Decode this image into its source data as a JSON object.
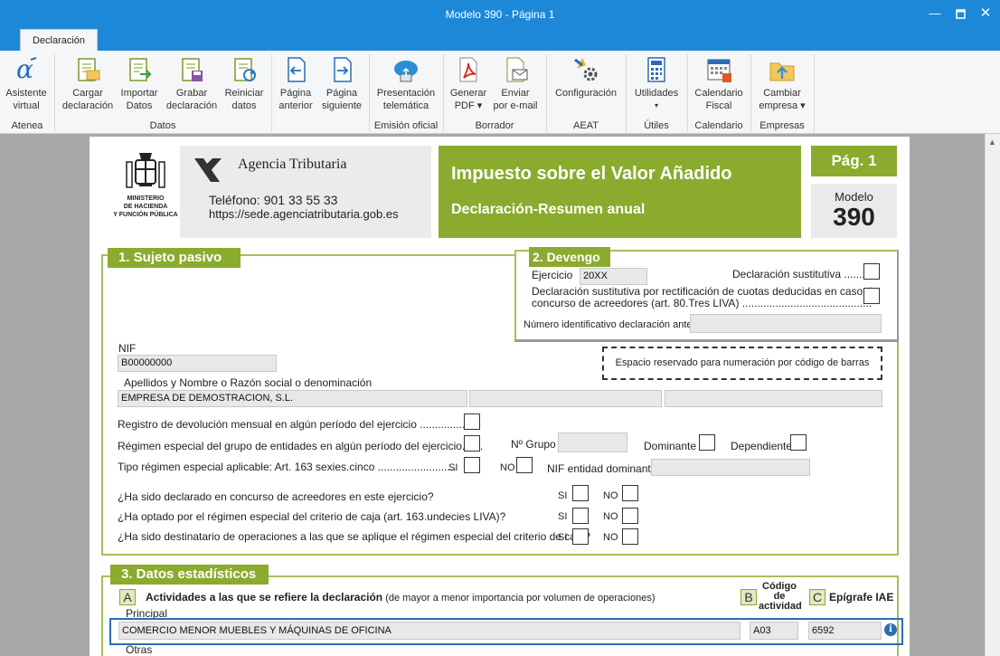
{
  "window": {
    "title": "Modelo 390 - Página 1"
  },
  "tabs": {
    "declaracion": "Declaración"
  },
  "ribbon": {
    "asistente": "Asistente",
    "virtual": "virtual",
    "cargar": "Cargar",
    "cargar2": "declaración",
    "importar": "Importar",
    "importar2": "Datos",
    "grabar": "Grabar",
    "grabar2": "declaración",
    "reiniciar": "Reiniciar",
    "reiniciar2": "datos",
    "pag_ant": "Página",
    "pag_ant2": "anterior",
    "pag_sig": "Página",
    "pag_sig2": "siguiente",
    "present": "Presentación",
    "present2": "telemática",
    "generar": "Generar",
    "generar2": "PDF ▾",
    "enviar": "Enviar",
    "enviar2": "por e-mail",
    "config": "Configuración",
    "utilidades": "Utilidades",
    "utilidades2": "▾",
    "calendario": "Calendario",
    "calendario2": "Fiscal",
    "cambiar": "Cambiar",
    "cambiar2": "empresa ▾",
    "groups": {
      "atenea": "Atenea",
      "datos": "Datos",
      "emision": "Emisión oficial",
      "borrador": "Borrador",
      "aeat": "AEAT",
      "utiles": "Útiles",
      "calendario": "Calendario",
      "empresas": "Empresas"
    }
  },
  "header": {
    "ministerio": "MINISTERIO",
    "de_hacienda": "DE HACIENDA",
    "funcion": "Y FUNCIÓN PÚBLICA",
    "agencia": "Agencia Tributaria",
    "telefono": "Teléfono: 901 33 55 33",
    "web": "https://sede.agenciatributaria.gob.es",
    "impuesto": "Impuesto sobre el Valor Añadido",
    "subtitulo": "Declaración-Resumen anual",
    "pag": "Pág. 1",
    "modelo_lbl": "Modelo",
    "modelo_num": "390"
  },
  "s1": {
    "title": "1. Sujeto pasivo",
    "nif_lbl": "NIF",
    "nif": "B00000000",
    "nombre_lbl": "Apellidos y Nombre o Razón social o denominación",
    "nombre": "EMPRESA DE DEMOSTRACION, S.L.",
    "barras": "Espacio reservado para numeración por código de barras",
    "reg_dev": "Registro de devolución mensual en algún período del ejercicio ..................",
    "reg_grupo": "Régimen especial del grupo de entidades en algún período del ejercicio.......",
    "n_grupo": "Nº Grupo",
    "dominante": "Dominante",
    "dependiente": "Dependiente",
    "tipo_reg": "Tipo régimen especial aplicable: Art. 163 sexies.cinco ..........................",
    "si": "SI",
    "no": "NO",
    "nif_dom": "NIF entidad dominante",
    "q1": "¿Ha sido declarado en concurso de acreedores en este ejercicio?",
    "q2": "¿Ha optado por el régimen especial del criterio de caja (art. 163.undecies LIVA)?",
    "q3": "¿Ha sido destinatario de operaciones a las que se aplique el régimen especial del criterio de caja?"
  },
  "s2": {
    "title": "2. Devengo",
    "ejercicio_lbl": "Ejercicio",
    "ejercicio": "20XX",
    "sustitutiva": "Declaración sustitutiva ........",
    "rect1": "Declaración sustitutiva por rectificación de cuotas deducidas en caso de",
    "rect2": "concurso de acreedores (art. 80.Tres LIVA) ...........................................",
    "num_ant": "Número identificativo declaración anterior"
  },
  "s3": {
    "title": "3. Datos estadísticos",
    "a": "A",
    "b": "B",
    "c": "C",
    "actividades": "Actividades a las que se refiere la declaración",
    "actividades_note": " (de mayor a menor importancia por volumen de operaciones)",
    "codigo1": "Código",
    "codigo2": "de",
    "codigo3": "actividad",
    "epigrafe": "Epígrafe IAE",
    "principal": "Principal",
    "actividad": "COMERCIO MENOR MUEBLES Y MÁQUINAS DE OFICINA",
    "codigo": "A03",
    "iae": "6592",
    "otras": "Otras"
  }
}
